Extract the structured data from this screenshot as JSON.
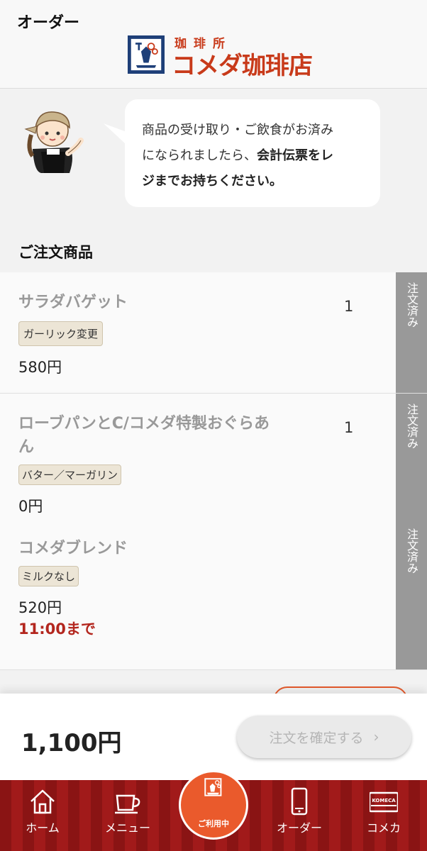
{
  "header": {
    "title": "オーダー",
    "logo_sub": "珈琲所",
    "logo_main": "コメダ珈琲店",
    "logo_reg": "®"
  },
  "notice": {
    "line1": "商品の受け取り・ご飲食がお済み",
    "line2_plain": "になられましたら、",
    "line2_bold": "会計伝票をレ",
    "line3_bold": "ジまでお持ちください。"
  },
  "orders": {
    "section_title": "ご注文商品",
    "status_label": "注文済み",
    "items": [
      {
        "name": "サラダバゲット",
        "option": "ガーリック変更",
        "price": "580円",
        "qty": "1"
      },
      {
        "name": "ローブパンとC/コメダ特製おぐらあん",
        "option": "バター／マーガリン",
        "price": "0円",
        "qty": "1"
      },
      {
        "name": "コメダブレンド",
        "option": "ミルクなし",
        "price": "520円"
      }
    ],
    "deadline": "11:00まで"
  },
  "footer": {
    "total": "1,100円",
    "confirm_label": "注文を確定する",
    "confirm_chevron": "›"
  },
  "tabbar": {
    "home": "ホーム",
    "menu": "メニュー",
    "center": "ご利用中",
    "order": "オーダー",
    "card": "コメカ",
    "card_icon_text": "KOMECA"
  },
  "colors": {
    "brand_red": "#c83a1a",
    "accent_orange": "#ea5a2c",
    "deadline_red": "#b3261e",
    "tabbar_red": "#8a1414",
    "status_gray": "#999999"
  }
}
